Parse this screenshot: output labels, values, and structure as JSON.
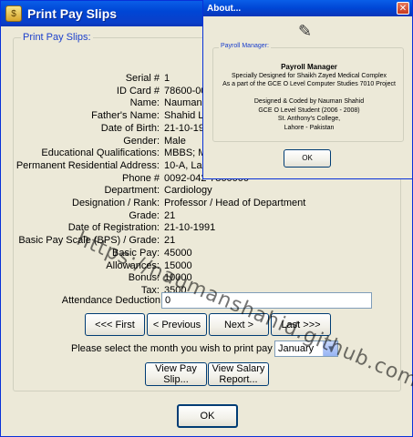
{
  "window": {
    "title": "Print Pay Slips"
  },
  "group_label": "Print Pay Slips:",
  "fields": [
    {
      "label": "Serial #",
      "value": "1"
    },
    {
      "label": "ID Card #",
      "value": "78600-000"
    },
    {
      "label": "Name:",
      "value": "Nauman S"
    },
    {
      "label": "Father's Name:",
      "value": "Shahid Lal"
    },
    {
      "label": "Date of Birth:",
      "value": "21-10-1971"
    },
    {
      "label": "Gender:",
      "value": "Male"
    },
    {
      "label": "Educational Qualifications:",
      "value": "MBBS; MD"
    },
    {
      "label": "Permanent Residential Address:",
      "value": "10-A, Lane"
    },
    {
      "label": "Phone #",
      "value": "0092-042-7860000"
    },
    {
      "label": "Department:",
      "value": "Cardiology"
    },
    {
      "label": "Designation / Rank:",
      "value": "Professor / Head of Department"
    },
    {
      "label": "Grade:",
      "value": "21"
    },
    {
      "label": "Date of Registration:",
      "value": "21-10-1991"
    },
    {
      "label": "Basic Pay Scale (BPS) / Grade:",
      "value": "21"
    },
    {
      "label": "Basic Pay:",
      "value": "45000"
    },
    {
      "label": "Allowances:",
      "value": "15000"
    },
    {
      "label": "Bonus:",
      "value": "10000"
    },
    {
      "label": "Tax:",
      "value": "3500"
    }
  ],
  "attendance": {
    "label": "Attendance Deduction",
    "value": "0"
  },
  "nav": {
    "first": "<<< First",
    "previous": "< Previous",
    "next": "Next >",
    "last": "Last >>>"
  },
  "month": {
    "label": "Please select the month you wish to print pay slips for:",
    "selected": "January"
  },
  "actions": {
    "view_pay_slip": "View Pay Slip...",
    "view_salary_report_line1": "View Salary",
    "view_salary_report_line2": "Report..."
  },
  "ok_label": "OK",
  "about": {
    "title": "About...",
    "group_label": "Payroll Manager:",
    "lines": [
      "Payroll Manager",
      "Specially Designed for Shaikh Zayed Medical Complex",
      "As a part of the GCE O Level Computer Studies 7010 Project",
      "",
      "Designed & Coded by Nauman Shahid",
      "GCE O Level Student (2006 - 2008)",
      "St. Anthony's College,",
      "Lahore - Pakistan"
    ],
    "ok_label": "OK"
  },
  "watermark": "https://naumanshahid.github.com/"
}
